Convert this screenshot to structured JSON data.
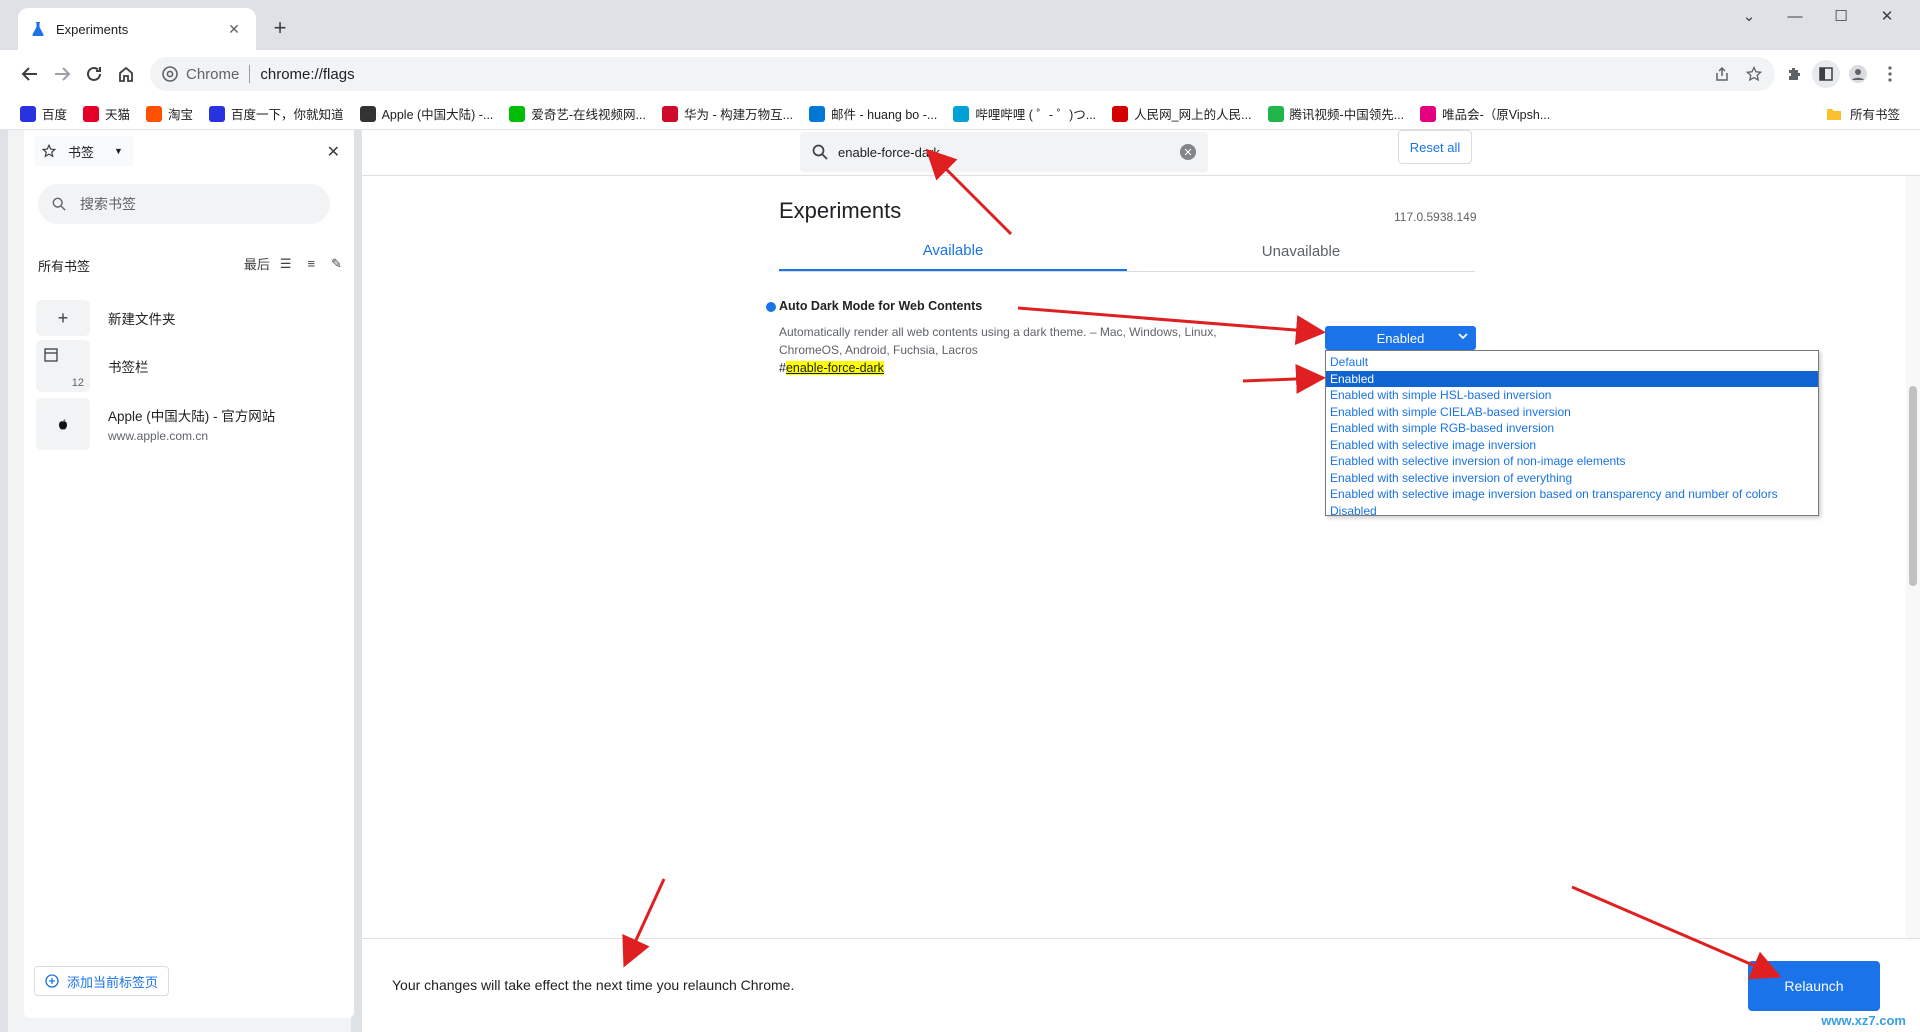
{
  "browser": {
    "tab_title": "Experiments",
    "new_tab": "+",
    "site_label": "Chrome",
    "url": "chrome://flags",
    "window_controls": [
      "⌄",
      "—",
      "☐",
      "✕"
    ]
  },
  "bookmarks_bar": {
    "items": [
      {
        "label": "百度",
        "color": "#2932e1",
        "icon": "baidu-icon"
      },
      {
        "label": "天猫",
        "color": "#e4002b",
        "icon": "tmall-icon"
      },
      {
        "label": "淘宝",
        "color": "#ff5000",
        "icon": "taobao-icon"
      },
      {
        "label": "百度一下，你就知道",
        "color": "#2932e1",
        "icon": "baidu-icon"
      },
      {
        "label": "Apple (中国大陆) -...",
        "color": "#333333",
        "icon": "apple-icon"
      },
      {
        "label": "爱奇艺-在线视频网...",
        "color": "#00be06",
        "icon": "iqiyi-icon"
      },
      {
        "label": "华为 - 构建万物互...",
        "color": "#cf0a2c",
        "icon": "huawei-icon"
      },
      {
        "label": "邮件 - huang bo -...",
        "color": "#0078d4",
        "icon": "outlook-icon"
      },
      {
        "label": "哔哩哔哩 ( ゜- ゜)つ...",
        "color": "#00a1d6",
        "icon": "bilibili-icon"
      },
      {
        "label": "人民网_网上的人民...",
        "color": "#d40000",
        "icon": "people-icon"
      },
      {
        "label": "腾讯视频-中国领先...",
        "color": "#20b74a",
        "icon": "tencent-video-icon"
      },
      {
        "label": "唯品会-（原Vipsh...",
        "color": "#e4007f",
        "icon": "vip-icon"
      }
    ],
    "all_bookmarks": "所有书签"
  },
  "side_panel": {
    "selector_label": "书签",
    "search_placeholder": "搜索书签",
    "heading": "所有书签",
    "sort_label": "最后",
    "rows": [
      {
        "title": "新建文件夹",
        "subtitle": "",
        "icon": "plus-icon"
      },
      {
        "title": "书签栏",
        "subtitle": "",
        "count": "12",
        "icon": "folder-icon"
      },
      {
        "title": "Apple (中国大陆) - 官方网站",
        "subtitle": "www.apple.com.cn",
        "icon": "apple-icon"
      }
    ],
    "add_current_tab": "添加当前标签页"
  },
  "flags": {
    "search_value": "enable-force-dark",
    "reset_all": "Reset all",
    "title": "Experiments",
    "version": "117.0.5938.149",
    "tabs": [
      "Available",
      "Unavailable"
    ],
    "experiment": {
      "name": "Auto Dark Mode for Web Contents",
      "description": "Automatically render all web contents using a dark theme. – Mac, Windows, Linux, ChromeOS, Android, Fuchsia, Lacros",
      "link_hash": "#",
      "link_text": "enable-force-dark",
      "selected": "Enabled",
      "options": [
        "Default",
        "Enabled",
        "Enabled with simple HSL-based inversion",
        "Enabled with simple CIELAB-based inversion",
        "Enabled with simple RGB-based inversion",
        "Enabled with selective image inversion",
        "Enabled with selective inversion of non-image elements",
        "Enabled with selective inversion of everything",
        "Enabled with selective image inversion based on transparency and number of colors",
        "Disabled"
      ]
    },
    "footer_message": "Your changes will take effect the next time you relaunch Chrome.",
    "relaunch": "Relaunch"
  },
  "watermark": "www.xz7.com",
  "colors": {
    "accent": "#1a73e8",
    "annotation_arrow": "#e02020",
    "highlight": "#ffff00"
  }
}
